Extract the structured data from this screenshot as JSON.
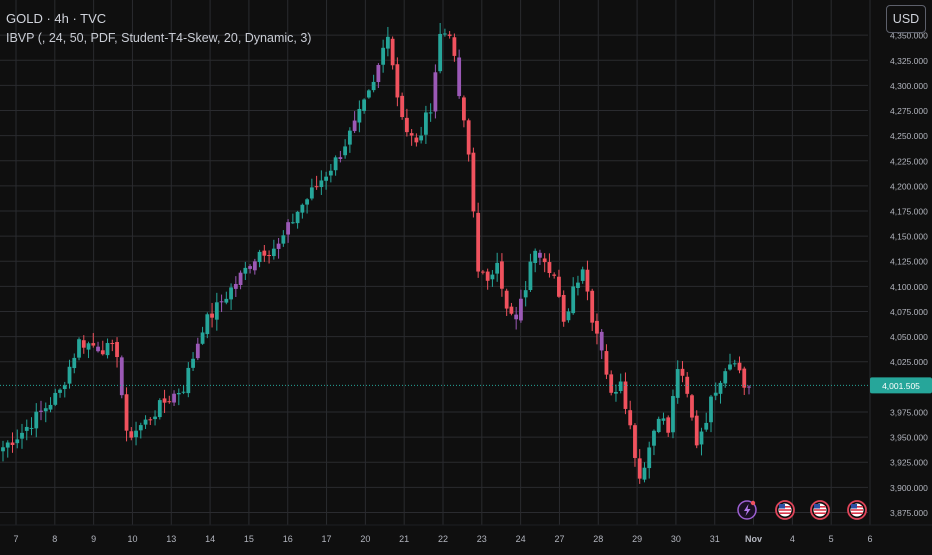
{
  "header": {
    "title": "GOLD · 4h · TVC",
    "indicator": "IBVP (, 24, 50, PDF, Student-T4-Skew, 20, Dynamic, 3)"
  },
  "currency_button": "USD",
  "colors": {
    "background": "#0f0f0f",
    "grid": "#2a2b2f",
    "up": "#26a69a",
    "down": "#f0525e",
    "indicator_candle": "#9b59b6",
    "last_price_line": "#26a69a",
    "axis_text": "#b2b5be"
  },
  "chart_data": {
    "type": "candlestick",
    "title": "",
    "xlabel": "",
    "ylabel": "",
    "ylim": [
      3862.5,
      4385
    ],
    "y_ticks": [
      3875,
      3900,
      3925,
      3950,
      3975,
      4025,
      4050,
      4075,
      4100,
      4125,
      4150,
      4175,
      4200,
      4225,
      4250,
      4275,
      4300,
      4325,
      4350
    ],
    "y_tick_labels": [
      "3,875.000",
      "3,900.000",
      "3,925.000",
      "3,950.000",
      "3,975.000",
      "4,025.000",
      "4,050.000",
      "4,075.000",
      "4,100.000",
      "4,125.000",
      "4,150.000",
      "4,175.000",
      "4,200.000",
      "4,225.000",
      "4,250.000",
      "4,275.000",
      "4,300.000",
      "4,325.000",
      "4,350.000"
    ],
    "last_price": 4001.505,
    "last_price_label": "4,001.505",
    "x_labels": [
      "7",
      "8",
      "9",
      "10",
      "13",
      "14",
      "15",
      "16",
      "17",
      "20",
      "21",
      "22",
      "23",
      "24",
      "27",
      "28",
      "29",
      "30",
      "31",
      "Nov",
      "4",
      "5",
      "6"
    ],
    "key_points": [
      [
        0,
        3940
      ],
      [
        4,
        3955
      ],
      [
        8,
        3975
      ],
      [
        12,
        3995
      ],
      [
        16,
        4045
      ],
      [
        20,
        4040
      ],
      [
        24,
        4035
      ],
      [
        26,
        3950
      ],
      [
        30,
        3965
      ],
      [
        34,
        3985
      ],
      [
        38,
        4000
      ],
      [
        42,
        4060
      ],
      [
        46,
        4085
      ],
      [
        50,
        4110
      ],
      [
        54,
        4135
      ],
      [
        58,
        4140
      ],
      [
        62,
        4175
      ],
      [
        66,
        4200
      ],
      [
        70,
        4225
      ],
      [
        74,
        4260
      ],
      [
        78,
        4300
      ],
      [
        81,
        4355
      ],
      [
        83,
        4290
      ],
      [
        85,
        4255
      ],
      [
        87,
        4240
      ],
      [
        90,
        4280
      ],
      [
        92,
        4350
      ],
      [
        94,
        4355
      ],
      [
        96,
        4290
      ],
      [
        98,
        4230
      ],
      [
        100,
        4120
      ],
      [
        102,
        4100
      ],
      [
        104,
        4130
      ],
      [
        106,
        4075
      ],
      [
        108,
        4065
      ],
      [
        110,
        4100
      ],
      [
        112,
        4140
      ],
      [
        114,
        4130
      ],
      [
        116,
        4110
      ],
      [
        118,
        4060
      ],
      [
        120,
        4100
      ],
      [
        122,
        4120
      ],
      [
        124,
        4070
      ],
      [
        126,
        4040
      ],
      [
        128,
        3990
      ],
      [
        130,
        4010
      ],
      [
        132,
        3960
      ],
      [
        134,
        3910
      ],
      [
        136,
        3940
      ],
      [
        138,
        3975
      ],
      [
        140,
        3955
      ],
      [
        142,
        4020
      ],
      [
        144,
        3990
      ],
      [
        146,
        3945
      ],
      [
        148,
        3970
      ],
      [
        150,
        4000
      ],
      [
        152,
        4020
      ],
      [
        154,
        4030
      ],
      [
        156,
        4000
      ],
      [
        157,
        4002
      ]
    ],
    "up_color": "#26a69a",
    "down_color": "#f0525e"
  },
  "event_markers": [
    {
      "icon": "lightning-icon",
      "label": ""
    },
    {
      "icon": "us-flag-icon",
      "label": ""
    },
    {
      "icon": "us-flag-icon",
      "label": ""
    },
    {
      "icon": "us-flag-icon",
      "label": ""
    }
  ]
}
